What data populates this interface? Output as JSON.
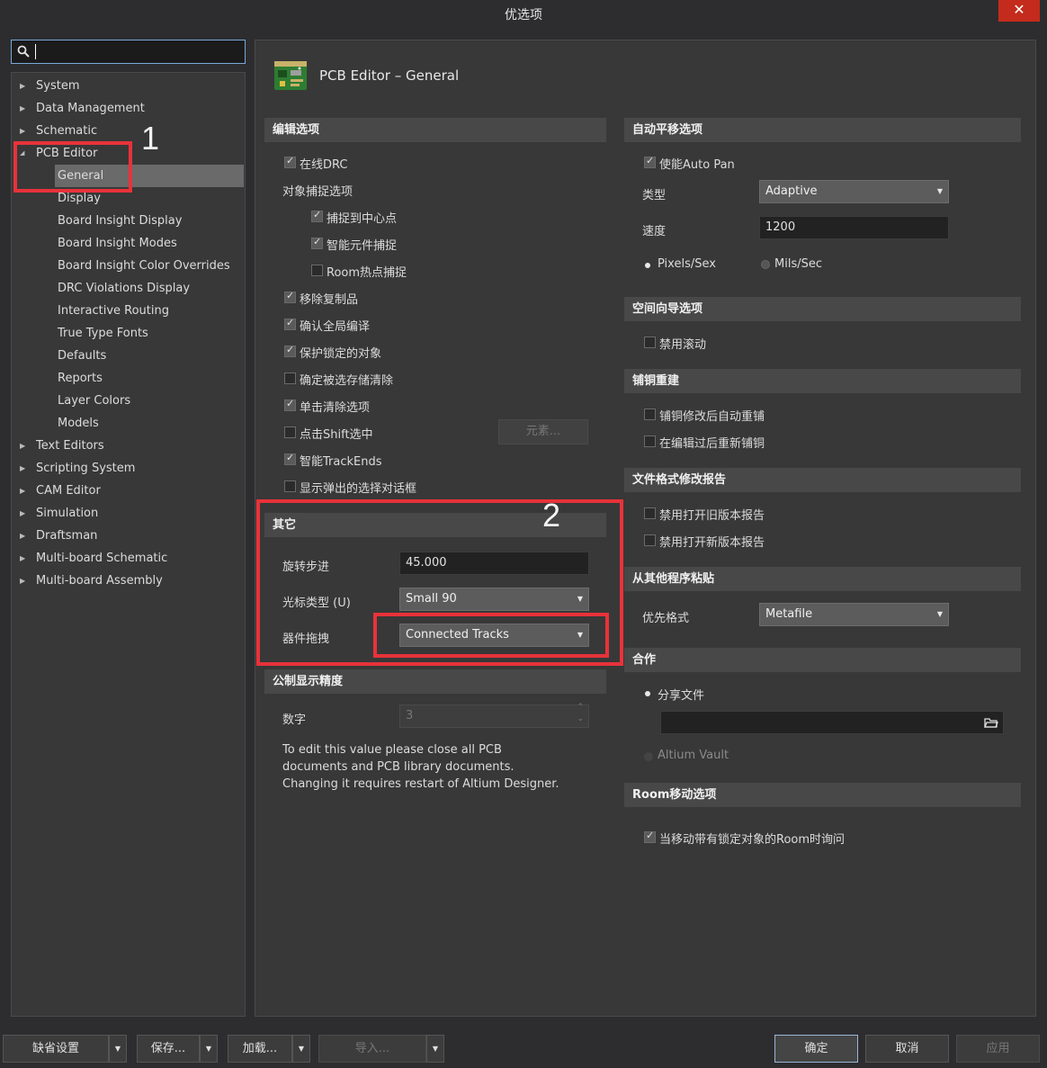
{
  "window": {
    "title": "优选项"
  },
  "search": {
    "placeholder": ""
  },
  "tree": {
    "items": [
      {
        "label": "System",
        "expanded": false
      },
      {
        "label": "Data Management",
        "expanded": false
      },
      {
        "label": "Schematic",
        "expanded": false
      },
      {
        "label": "PCB Editor",
        "expanded": true
      },
      {
        "label": "General",
        "selected": true
      },
      {
        "label": "Display"
      },
      {
        "label": "Board Insight Display"
      },
      {
        "label": "Board Insight Modes"
      },
      {
        "label": "Board Insight Color Overrides"
      },
      {
        "label": "DRC Violations Display"
      },
      {
        "label": "Interactive Routing"
      },
      {
        "label": "True Type Fonts"
      },
      {
        "label": "Defaults"
      },
      {
        "label": "Reports"
      },
      {
        "label": "Layer Colors"
      },
      {
        "label": "Models"
      },
      {
        "label": "Text Editors",
        "expanded": false
      },
      {
        "label": "Scripting System",
        "expanded": false
      },
      {
        "label": "CAM Editor",
        "expanded": false
      },
      {
        "label": "Simulation",
        "expanded": false
      },
      {
        "label": "Draftsman",
        "expanded": false
      },
      {
        "label": "Multi-board Schematic",
        "expanded": false
      },
      {
        "label": "Multi-board Assembly",
        "expanded": false
      }
    ]
  },
  "page": {
    "title": "PCB Editor – General",
    "icon": "pcb-board-icon"
  },
  "edit_options": {
    "header": "编辑选项",
    "online_drc": {
      "label": "在线DRC",
      "checked": true
    },
    "snap_group": "对象捕捉选项",
    "snap_center": {
      "label": "捕捉到中心点",
      "checked": true
    },
    "smart_snap": {
      "label": "智能元件捕捉",
      "checked": true
    },
    "room_snap": {
      "label": "Room热点捕捉",
      "checked": false
    },
    "remove_dup": {
      "label": "移除复制品",
      "checked": true
    },
    "confirm_global": {
      "label": "确认全局编译",
      "checked": true
    },
    "protect_locked": {
      "label": "保护锁定的对象",
      "checked": true
    },
    "confirm_clear": {
      "label": "确定被选存储清除",
      "checked": false
    },
    "click_clear": {
      "label": "单击清除选项",
      "checked": true
    },
    "shift_select": {
      "label": "点击Shift选中",
      "checked": false
    },
    "elements_button": "元素...",
    "smart_track_ends": {
      "label": "智能TrackEnds",
      "checked": true
    },
    "popup_dialog": {
      "label": "显示弹出的选择对话框",
      "checked": false
    }
  },
  "other": {
    "header": "其它",
    "rotation_label": "旋转步进",
    "rotation_value": "45.000",
    "cursor_label": "光标类型 (U)",
    "cursor_value": "Small 90",
    "drag_label": "器件拖拽",
    "drag_value": "Connected Tracks"
  },
  "metric": {
    "header": "公制显示精度",
    "digits_label": "数字",
    "digits_value": "3",
    "note": "To edit this value please close all PCB documents and PCB library documents. Changing it requires restart of Altium Designer."
  },
  "autopan": {
    "header": "自动平移选项",
    "enable": {
      "label": "使能Auto Pan",
      "checked": true
    },
    "type_label": "类型",
    "type_value": "Adaptive",
    "speed_label": "速度",
    "speed_value": "1200",
    "radio_pixels": "Pixels/Sex",
    "radio_mils": "Mils/Sec",
    "selected": "Pixels/Sex"
  },
  "space_nav": {
    "header": "空间向导选项",
    "disable_scroll": {
      "label": "禁用滚动",
      "checked": false
    }
  },
  "polygon": {
    "header": "铺铜重建",
    "auto_repour": {
      "label": "铺铜修改后自动重铺",
      "checked": false
    },
    "repour_after_edit": {
      "label": "在编辑过后重新铺铜",
      "checked": false
    }
  },
  "file_format": {
    "header": "文件格式修改报告",
    "disable_old": {
      "label": "禁用打开旧版本报告",
      "checked": false
    },
    "disable_new": {
      "label": "禁用打开新版本报告",
      "checked": false
    }
  },
  "paste": {
    "header": "从其他程序粘贴",
    "pref_label": "优先格式",
    "pref_value": "Metafile"
  },
  "collab": {
    "header": "合作",
    "shared_files": "分享文件",
    "path_value": "",
    "altium_vault": "Altium Vault"
  },
  "room": {
    "header": "Room移动选项",
    "ask_locked": {
      "label": "当移动带有锁定对象的Room时询问",
      "checked": true
    }
  },
  "annotations": {
    "one": "1",
    "two": "2"
  },
  "bottom": {
    "defaults": "缺省设置",
    "save": "保存...",
    "load": "加载...",
    "import": "导入...",
    "ok": "确定",
    "cancel": "取消",
    "apply": "应用"
  },
  "colors": {
    "annotation_red": "#e8323a",
    "background": "#2d2d30",
    "panel": "#383838"
  }
}
